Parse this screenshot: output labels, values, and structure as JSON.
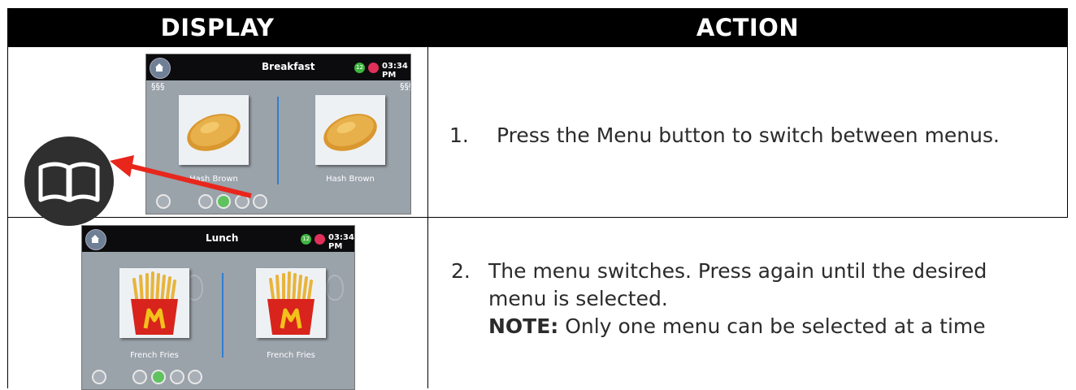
{
  "header": {
    "display_label": "DISPLAY",
    "action_label": "ACTION"
  },
  "rows": [
    {
      "screen": {
        "title": "Breakfast",
        "badge": "12",
        "time": "03:34 PM",
        "items": [
          "Hash Brown",
          "Hash Brown"
        ]
      },
      "step_number": "1.",
      "step_text": "Press the Menu button to switch between menus."
    },
    {
      "screen": {
        "title": "Lunch",
        "badge": "12",
        "time": "03:34 PM",
        "items": [
          "French Fries",
          "French Fries"
        ]
      },
      "step_number": "2.",
      "step_line1": "The menu switches. Press again until the desired",
      "step_line2": "menu is selected.",
      "note_label": "NOTE:",
      "note_text": " Only one menu can be selected at a time"
    }
  ],
  "icons": [
    "home-icon",
    "steam-icon",
    "power-icon",
    "globe-icon",
    "hand-icon",
    "thermometer-icon",
    "menu-book-icon",
    "arrow-icon"
  ],
  "colors": {
    "header_bg": "#000000",
    "arrow": "#e8261c",
    "divider_blue": "#2e7fd0",
    "badge_green": "#3fb53f",
    "badge_red": "#e0305a"
  }
}
